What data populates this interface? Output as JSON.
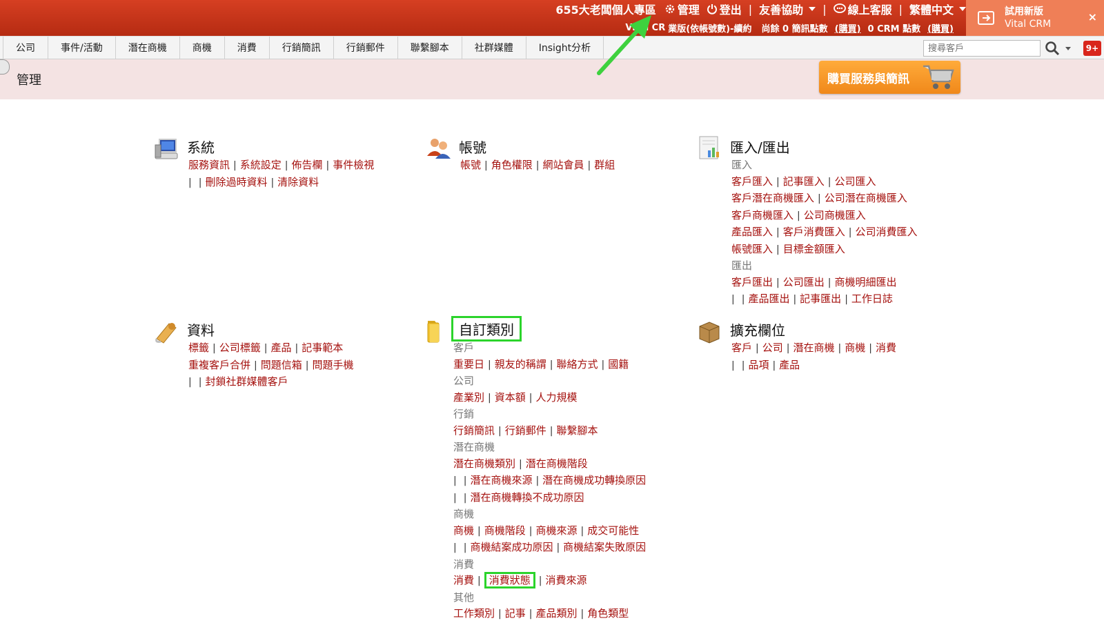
{
  "header": {
    "user": "655大老闆個人專區",
    "admin": "管理",
    "logout": "登出",
    "partners": "友善協助",
    "support": "線上客服",
    "language": "繁體中文",
    "plan_prefix": "Vital CR",
    "plan_rest": "業版(依帳號數)-續約",
    "sms_text": "尚餘 0 簡訊點數",
    "buy1": "(購買)",
    "crm_text": "0 CRM 點數",
    "buy2": "(購買)",
    "trial_line1": "試用新版",
    "trial_line2": "Vital CRM",
    "close": "×",
    "sep": "|"
  },
  "nav": {
    "items": [
      "公司",
      "事件/活動",
      "潛在商機",
      "商機",
      "消費",
      "行銷簡訊",
      "行銷郵件",
      "聯繫腳本",
      "社群媒體",
      "Insight分析"
    ],
    "search_placeholder": "搜尋客戶",
    "notif_badge": "9+"
  },
  "title_band": {
    "title": "管理",
    "buy_button": "購買服務與簡訊"
  },
  "sections": {
    "system": {
      "title": "系統",
      "lines": [
        [
          "服務資訊",
          "系統設定",
          "佈告欄",
          "事件檢視"
        ],
        [
          "",
          "刪除過時資料",
          "清除資料"
        ]
      ]
    },
    "account": {
      "title": "帳號",
      "lines": [
        [
          "帳號",
          "角色權限",
          "網站會員",
          "群組"
        ]
      ]
    },
    "io": {
      "title": "匯入/匯出",
      "import_label": "匯入",
      "import_lines": [
        [
          "客戶匯入",
          "記事匯入",
          "公司匯入"
        ],
        [
          "客戶潛在商機匯入",
          "公司潛在商機匯入"
        ],
        [
          "客戶商機匯入",
          "公司商機匯入"
        ],
        [
          "產品匯入",
          "客戶消費匯入",
          "公司消費匯入"
        ],
        [
          "帳號匯入",
          "目標金額匯入"
        ]
      ],
      "export_label": "匯出",
      "export_lines": [
        [
          "客戶匯出",
          "公司匯出",
          "商機明細匯出"
        ],
        [
          "",
          "產品匯出",
          "記事匯出",
          "工作日誌"
        ]
      ]
    },
    "data": {
      "title": "資料",
      "lines": [
        [
          "標籤",
          "公司標籤",
          "產品",
          "記事範本"
        ],
        [
          "重複客戶合併",
          "問題信箱",
          "問題手機"
        ],
        [
          "",
          "封鎖社群媒體客戶"
        ]
      ]
    },
    "custom": {
      "title": "自訂類別",
      "customer_label": "客戶",
      "customer_lines": [
        [
          "重要日",
          "親友的稱謂",
          "聯絡方式",
          "國籍"
        ]
      ],
      "company_label": "公司",
      "company_lines": [
        [
          "產業別",
          "資本額",
          "人力規模"
        ]
      ],
      "marketing_label": "行銷",
      "marketing_lines": [
        [
          "行銷簡訊",
          "行銷郵件",
          "聯繫腳本"
        ]
      ],
      "lead_label": "潛在商機",
      "lead_lines": [
        [
          "潛在商機類別",
          "潛在商機階段"
        ],
        [
          "",
          "潛在商機來源",
          "潛在商機成功轉換原因"
        ],
        [
          "",
          "潛在商機轉換不成功原因"
        ]
      ],
      "opp_label": "商機",
      "opp_lines": [
        [
          "商機",
          "商機階段",
          "商機來源",
          "成交可能性"
        ],
        [
          "",
          "商機結案成功原因",
          "商機結案失敗原因"
        ]
      ],
      "consume_label": "消費",
      "consume_items": [
        "消費",
        "消費狀態",
        "消費來源"
      ],
      "other_label": "其他",
      "other_lines": [
        [
          "工作類別",
          "記事",
          "產品類別",
          "角色類型"
        ]
      ]
    },
    "extend": {
      "title": "擴充欄位",
      "lines": [
        [
          "客戶",
          "公司",
          "潛在商機",
          "商機",
          "消費"
        ],
        [
          "",
          "品項",
          "產品"
        ]
      ]
    }
  },
  "colors": {
    "header_red": "#c7351a",
    "link_red": "#a5120f",
    "highlight_green": "#2bd42b",
    "buy_orange": "#f7941d"
  }
}
